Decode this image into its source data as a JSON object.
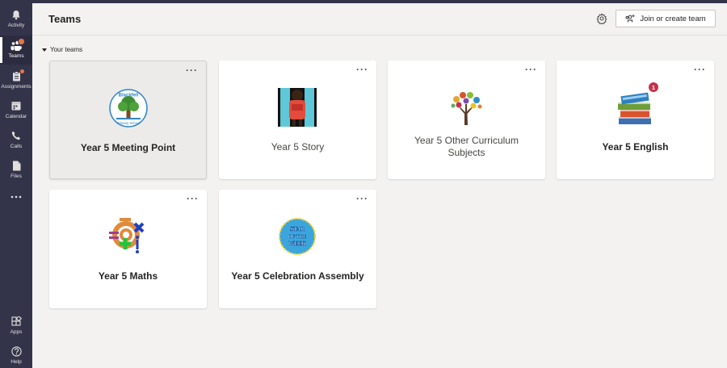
{
  "rail": {
    "items": [
      {
        "label": "Activity",
        "icon": "bell-icon"
      },
      {
        "label": "Teams",
        "icon": "teams-icon",
        "active": true
      },
      {
        "label": "Assignments",
        "icon": "assignments-icon"
      },
      {
        "label": "Calendar",
        "icon": "calendar-icon"
      },
      {
        "label": "Calls",
        "icon": "phone-icon"
      },
      {
        "label": "Files",
        "icon": "file-icon"
      },
      {
        "label": "",
        "icon": "more-icon"
      },
      {
        "label": "Apps",
        "icon": "apps-icon"
      },
      {
        "label": "Help",
        "icon": "help-icon"
      }
    ]
  },
  "header": {
    "title": "Teams",
    "join_label": "Join or create team"
  },
  "section": {
    "title": "Your teams"
  },
  "teams": [
    {
      "name": "Year 5 Meeting Point",
      "icon": "school-logo-icon",
      "logo_text_1": "Blackfell",
      "logo_text_2": "Primary School"
    },
    {
      "name": "Year 5 Story",
      "icon": "book-child-icon"
    },
    {
      "name": "Year 5 Other Curriculum Subjects",
      "icon": "tree-icon"
    },
    {
      "name": "Year 5 English",
      "icon": "books-icon",
      "badge": "1"
    },
    {
      "name": "Year 5 Maths",
      "icon": "math-symbols-icon"
    },
    {
      "name": "Year 5 Celebration Assembly",
      "icon": "star-badge-icon",
      "logo_text_1": "STAR",
      "logo_text_2": "OF THE",
      "logo_text_3": "WEEK"
    }
  ],
  "colors": {
    "rail": "#33344a",
    "accent": "#6264a7",
    "badge": "#c4314b",
    "background": "#f3f2f1"
  }
}
